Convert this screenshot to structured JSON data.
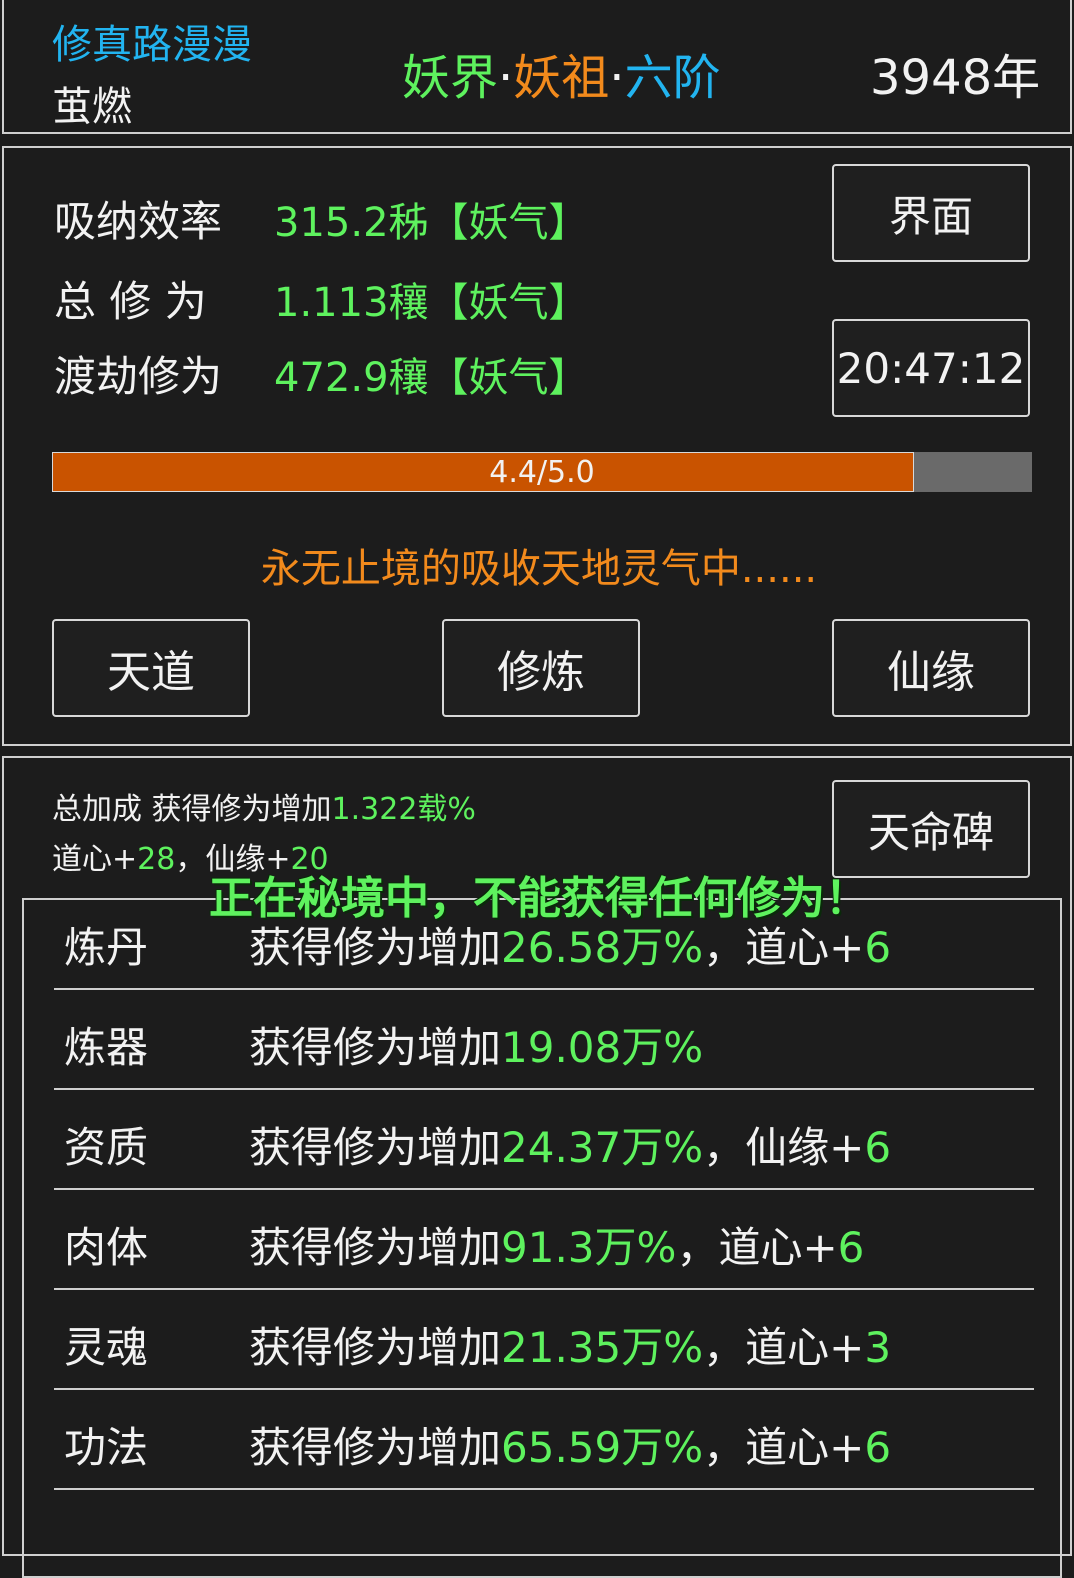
{
  "header": {
    "game_title": "修真路漫漫",
    "player_name": "茧燃",
    "realm_world": "妖界",
    "realm_rank": "妖祖",
    "realm_stage": "六阶",
    "separator": "·",
    "year": "3948年"
  },
  "stats": {
    "absorb_label": "吸纳效率",
    "absorb_value": "315.2秭【妖气】",
    "total_label": "总 修 为",
    "total_value": "1.113穰【妖气】",
    "tribulation_label": "渡劫修为",
    "tribulation_value": "472.9穰【妖气】",
    "interface_button": "界面",
    "clock": "20:47:12"
  },
  "progress": {
    "text": "4.4/5.0",
    "current": 4.4,
    "max": 5.0
  },
  "status_message": "永无止境的吸收天地灵气中......",
  "actions": {
    "heaven": "天道",
    "cultivate": "修炼",
    "fate": "仙缘"
  },
  "bonus": {
    "line1_prefix": "总加成 获得修为增加",
    "line1_value": "1.322载%",
    "line2_daoxin_label": "道心+",
    "line2_daoxin_value": "28",
    "line2_sep": "，",
    "line2_xianyuan_label": "仙缘+",
    "line2_xianyuan_value": "20",
    "stele_button": "天命碑"
  },
  "overlay_message": "正在秘境中，不能获得任何修为！",
  "skills": [
    {
      "name": "炼丹",
      "prefix": "获得修为增加",
      "value": "26.58万%",
      "suffix_label": "，道心+",
      "suffix_value": "6"
    },
    {
      "name": "炼器",
      "prefix": "获得修为增加",
      "value": "19.08万%",
      "suffix_label": "",
      "suffix_value": ""
    },
    {
      "name": "资质",
      "prefix": "获得修为增加",
      "value": "24.37万%",
      "suffix_label": "，仙缘+",
      "suffix_value": "6"
    },
    {
      "name": "肉体",
      "prefix": "获得修为增加",
      "value": "91.3万%",
      "suffix_label": "，道心+",
      "suffix_value": "6"
    },
    {
      "name": "灵魂",
      "prefix": "获得修为增加",
      "value": "21.35万%",
      "suffix_label": "，道心+",
      "suffix_value": "3"
    },
    {
      "name": "功法",
      "prefix": "获得修为增加",
      "value": "65.59万%",
      "suffix_label": "，道心+",
      "suffix_value": "6"
    }
  ],
  "colors": {
    "green": "#5ef25e",
    "orange": "#f28a1c",
    "cyan": "#22b4f0",
    "progress_fill": "#c95300",
    "progress_track": "#6a6a6a"
  }
}
